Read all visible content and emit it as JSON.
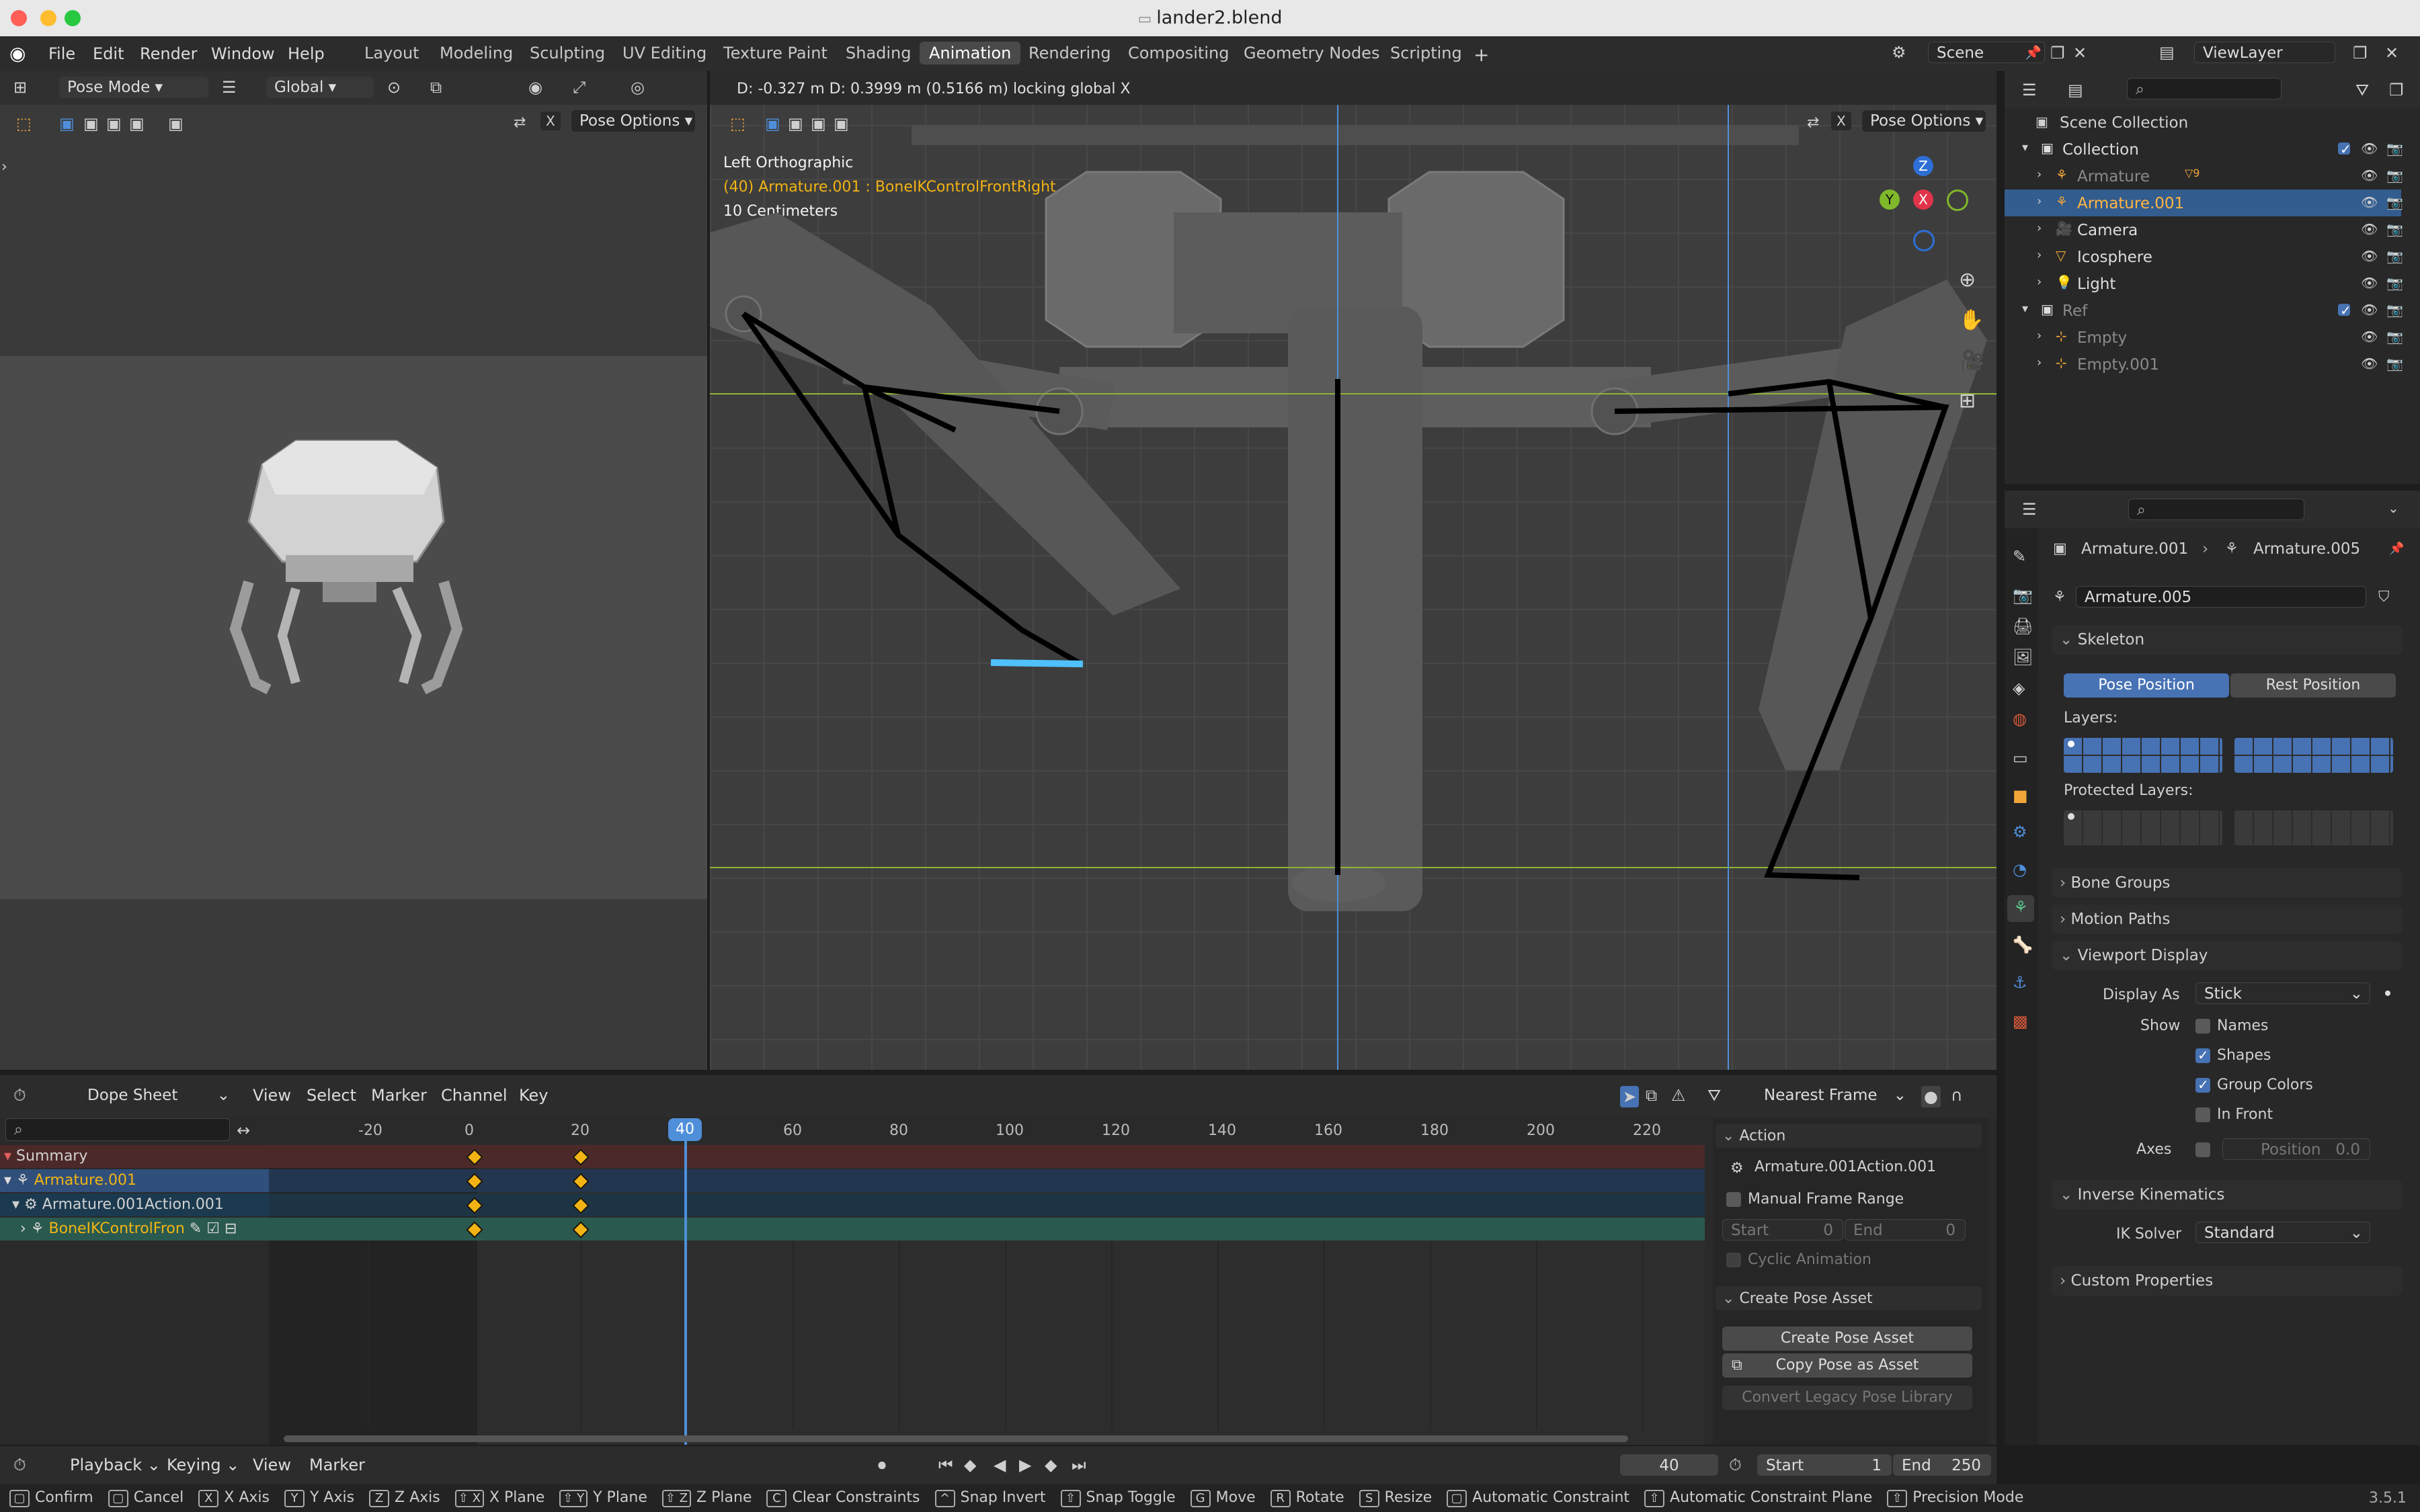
{
  "window": {
    "title": "lander2.blend"
  },
  "topbar": {
    "menus": [
      "File",
      "Edit",
      "Render",
      "Window",
      "Help"
    ],
    "workspaces": [
      "Layout",
      "Modeling",
      "Sculpting",
      "UV Editing",
      "Texture Paint",
      "Shading",
      "Animation",
      "Rendering",
      "Compositing",
      "Geometry Nodes",
      "Scripting"
    ],
    "active_workspace": "Animation",
    "scene": "Scene",
    "view_layer": "ViewLayer"
  },
  "camera_view": {
    "mode": "Pose Mode",
    "orientation": "Global",
    "pose_options": "Pose Options",
    "x_label": "X"
  },
  "viewport": {
    "status": "D: -0.327 m  D: 0.3999 m (0.5166 m) locking global X",
    "view_name": "Left Orthographic",
    "active_object": "(40) Armature.001 : BoneIKControlFrontRight",
    "scale": "10 Centimeters",
    "pose_options": "Pose Options",
    "x_label": "X",
    "gizmo": {
      "z": "Z",
      "y": "Y",
      "x": "X"
    }
  },
  "outliner": {
    "scene_collection": "Scene Collection",
    "items": [
      {
        "label": "Collection",
        "indent": 1
      },
      {
        "label": "Armature",
        "indent": 2,
        "badge": "9"
      },
      {
        "label": "Armature.001",
        "indent": 2,
        "selected": true
      },
      {
        "label": "Camera",
        "indent": 2
      },
      {
        "label": "Icosphere",
        "indent": 2
      },
      {
        "label": "Light",
        "indent": 2
      },
      {
        "label": "Ref",
        "indent": 1
      },
      {
        "label": "Empty",
        "indent": 2
      },
      {
        "label": "Empty.001",
        "indent": 2
      }
    ]
  },
  "properties": {
    "breadcrumb_object": "Armature.001",
    "breadcrumb_data": "Armature.005",
    "data_name": "Armature.005",
    "skeleton": {
      "title": "Skeleton",
      "pose_position": "Pose Position",
      "rest_position": "Rest Position",
      "layers_label": "Layers:",
      "protected_label": "Protected Layers:"
    },
    "bone_groups": "Bone Groups",
    "motion_paths": "Motion Paths",
    "viewport_display": {
      "title": "Viewport Display",
      "display_as_label": "Display As",
      "display_as_value": "Stick",
      "show_label": "Show",
      "names": "Names",
      "shapes": "Shapes",
      "group_colors": "Group Colors",
      "in_front": "In Front",
      "axes_label": "Axes",
      "position_label": "Position",
      "position_value": "0.0"
    },
    "inverse_kinematics": {
      "title": "Inverse Kinematics",
      "ik_solver_label": "IK Solver",
      "ik_solver_value": "Standard"
    },
    "custom_properties": "Custom Properties"
  },
  "dopesheet": {
    "editor": "Dope Sheet",
    "menus": [
      "View",
      "Select",
      "Marker",
      "Channel",
      "Key"
    ],
    "snap": "Nearest Frame",
    "ruler": [
      "-20",
      "0",
      "20",
      "40",
      "60",
      "80",
      "100",
      "120",
      "140",
      "160",
      "180",
      "200",
      "220"
    ],
    "current_frame": "40",
    "channels": [
      {
        "label": "Summary"
      },
      {
        "label": "Armature.001"
      },
      {
        "label": "Armature.001Action.001"
      },
      {
        "label": "BoneIKControlFron"
      }
    ],
    "keyframes": [
      0,
      20
    ],
    "action_panel": {
      "title": "Action",
      "action_name": "Armature.001Action.001",
      "manual_frame_range": "Manual Frame Range",
      "start_label": "Start",
      "start_value": "0",
      "end_label": "End",
      "end_value": "0",
      "cyclic": "Cyclic Animation"
    },
    "pose_asset_panel": {
      "title": "Create Pose Asset",
      "create": "Create Pose Asset",
      "copy": "Copy Pose as Asset",
      "convert": "Convert Legacy Pose Library"
    }
  },
  "timeline": {
    "menus": [
      "Playback",
      "Keying",
      "View",
      "Marker"
    ],
    "current_frame": "40",
    "start_label": "Start",
    "start_value": "1",
    "end_label": "End",
    "end_value": "250"
  },
  "statusbar": {
    "items": [
      {
        "key": "",
        "label": "Confirm"
      },
      {
        "key": "",
        "label": "Cancel"
      },
      {
        "key": "X",
        "label": "X Axis"
      },
      {
        "key": "Y",
        "label": "Y Axis"
      },
      {
        "key": "Z",
        "label": "Z Axis"
      },
      {
        "key": "⇧ X",
        "label": "X Plane"
      },
      {
        "key": "⇧ Y",
        "label": "Y Plane"
      },
      {
        "key": "⇧ Z",
        "label": "Z Plane"
      },
      {
        "key": "C",
        "label": "Clear Constraints"
      },
      {
        "key": "^",
        "label": "Snap Invert"
      },
      {
        "key": "⇧",
        "label": "Snap Toggle"
      },
      {
        "key": "G",
        "label": "Move"
      },
      {
        "key": "R",
        "label": "Rotate"
      },
      {
        "key": "S",
        "label": "Resize"
      },
      {
        "key": "",
        "label": "Automatic Constraint"
      },
      {
        "key": "⇧",
        "label": "Automatic Constraint Plane"
      },
      {
        "key": "⇧",
        "label": "Precision Mode"
      }
    ],
    "version": "3.5.1"
  }
}
